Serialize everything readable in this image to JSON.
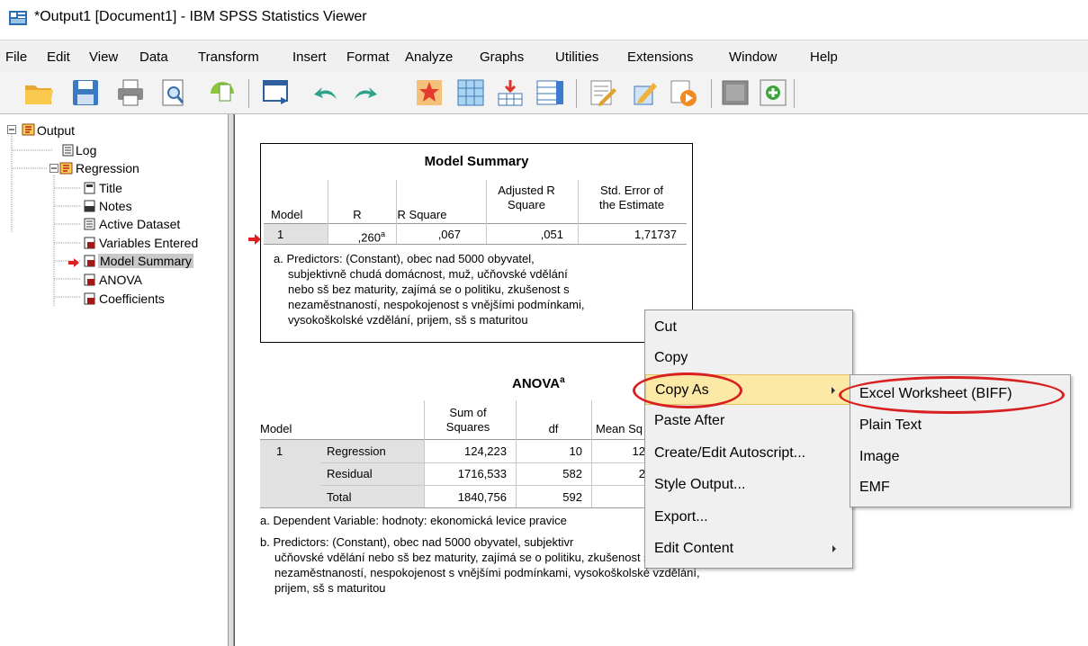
{
  "window": {
    "title": "*Output1 [Document1] - IBM SPSS Statistics Viewer"
  },
  "menu": [
    "File",
    "Edit",
    "View",
    "Data",
    "Transform",
    "Insert",
    "Format",
    "Analyze",
    "Graphs",
    "Utilities",
    "Extensions",
    "Window",
    "Help"
  ],
  "outline": {
    "root": "Output",
    "log": "Log",
    "regression": "Regression",
    "items": [
      "Title",
      "Notes",
      "Active Dataset",
      "Variables Entered",
      "Model Summary",
      "ANOVA",
      "Coefficients"
    ]
  },
  "model_summary": {
    "title": "Model Summary",
    "headers": [
      "Model",
      "R",
      "R Square",
      "Adjusted R\nSquare",
      "Std. Error of\nthe Estimate"
    ],
    "row": [
      "1",
      ",260",
      "a",
      ",067",
      ",051",
      "1,71737"
    ],
    "footnote": [
      "a. Predictors: (Constant), obec nad 5000 obyvatel,",
      "subjektivně chudá domácnost, muž, učňovské vdělání",
      "nebo sš bez maturity, zajímá se o politiku, zkušenost s",
      "nezaměstnaností, nespokojenost s vnějšími podmínkami,",
      "vysokoškolské vzdělání, prijem, sš s maturitou"
    ]
  },
  "anova": {
    "title": "ANOVA",
    "title_sup": "a",
    "headers": [
      "Model",
      "Sum of\nSquares",
      "df",
      "Mean Sq"
    ],
    "rows": [
      {
        "model": "1",
        "label": "Regression",
        "ss": "124,223",
        "df": "10",
        "ms": "12"
      },
      {
        "model": "",
        "label": "Residual",
        "ss": "1716,533",
        "df": "582",
        "ms": "2"
      },
      {
        "model": "",
        "label": "Total",
        "ss": "1840,756",
        "df": "592",
        "ms": ""
      }
    ],
    "footnote_a": "a. Dependent Variable: hodnoty: ekonomická levice pravice",
    "footnote_b": [
      "b. Predictors: (Constant), obec nad 5000 obyvatel, subjektivr",
      "učňovské vdělání nebo sš bez maturity, zajímá se o politiku, zkušenost s",
      "nezaměstnaností, nespokojenost s vnějšími podmínkami, vysokoškolské vzdělání,",
      "prijem, sš s maturitou"
    ]
  },
  "context_menu": {
    "items": [
      "Cut",
      "Copy",
      "Copy As",
      "Paste After",
      "Create/Edit Autoscript...",
      "Style Output...",
      "Export...",
      "Edit Content"
    ],
    "highlighted": "Copy As"
  },
  "submenu": {
    "items": [
      "Excel Worksheet (BIFF)",
      "Plain Text",
      "Image",
      "EMF"
    ]
  },
  "colors": {
    "highlight": "#fbe9a5",
    "annotation": "#d92020",
    "selection": "#c9c9c9"
  }
}
